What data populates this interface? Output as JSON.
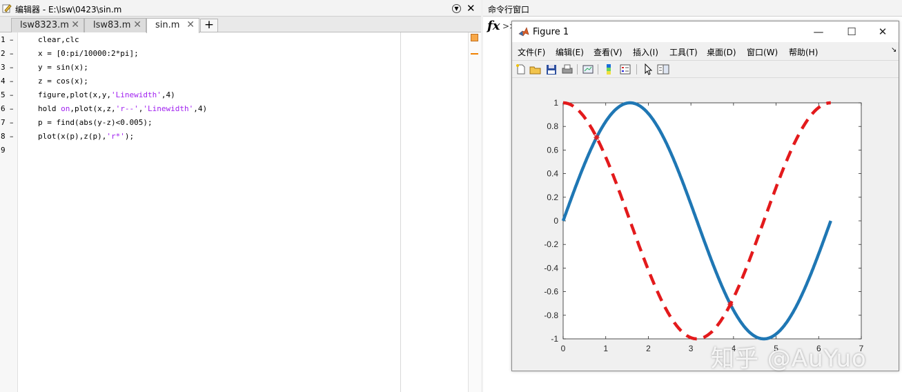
{
  "editor": {
    "title": "编辑器 - E:\\lsw\\0423\\sin.m",
    "tabs": [
      {
        "label": "lsw8323.m",
        "active": false
      },
      {
        "label": "lsw83.m",
        "active": false
      },
      {
        "label": "sin.m",
        "active": true
      }
    ],
    "add_tab": "+",
    "line_numbers": [
      "1",
      "2",
      "3",
      "4",
      "5",
      "6",
      "7",
      "8",
      "9"
    ],
    "line_markers": [
      "–",
      "–",
      "–",
      "–",
      "–",
      "–",
      "–",
      "–",
      ""
    ],
    "code": [
      [
        {
          "t": "clear,clc"
        }
      ],
      [
        {
          "t": "x = [0:pi/10000:2*pi];"
        }
      ],
      [
        {
          "t": "y = sin(x);"
        }
      ],
      [
        {
          "t": "z = cos(x);"
        }
      ],
      [
        {
          "t": "figure,plot(x,y,"
        },
        {
          "t": "'Linewidth'",
          "s": 1
        },
        {
          "t": ",4)"
        }
      ],
      [
        {
          "t": "hold "
        },
        {
          "t": "on",
          "s": 1
        },
        {
          "t": ",plot(x,z,"
        },
        {
          "t": "'r--'",
          "s": 1
        },
        {
          "t": ","
        },
        {
          "t": "'Linewidth'",
          "s": 1
        },
        {
          "t": ",4)"
        }
      ],
      [
        {
          "t": "p = find(abs(y-z)<0.005);"
        }
      ],
      [
        {
          "t": "plot(x(p),z(p),"
        },
        {
          "t": "'r*'",
          "s": 1
        },
        {
          "t": ");"
        }
      ],
      []
    ]
  },
  "command_window": {
    "title": "命令行窗口",
    "fx": "fx",
    "prompt": ">>"
  },
  "figure": {
    "title": "Figure 1",
    "window_buttons": [
      "—",
      "☐",
      "✕"
    ],
    "menu": [
      "文件(F)",
      "编辑(E)",
      "查看(V)",
      "插入(I)",
      "工具(T)",
      "桌面(D)",
      "窗口(W)",
      "帮助(H)"
    ],
    "toolbar_icons": [
      "new-figure-icon",
      "open-file-icon",
      "save-icon",
      "print-icon",
      "link-plot-icon",
      "colorbar-icon",
      "legend-icon",
      "pointer-icon",
      "property-editor-icon"
    ]
  },
  "watermark": "知乎 @AuYuo",
  "colors": {
    "sin": "#1f77b4",
    "cos": "#e31a1c",
    "marker": "#e31a1c"
  },
  "chart_data": {
    "type": "line",
    "xlim": [
      0,
      7
    ],
    "ylim": [
      -1,
      1
    ],
    "xticks": [
      0,
      1,
      2,
      3,
      4,
      5,
      6,
      7
    ],
    "yticks": [
      1,
      0.8,
      0.6,
      0.4,
      0.2,
      0,
      -0.2,
      -0.4,
      -0.6,
      -0.8,
      -1
    ],
    "series": [
      {
        "function": "sin",
        "style": "solid",
        "x_range": [
          0,
          6.2832
        ]
      },
      {
        "function": "cos",
        "style": "dashed",
        "x_range": [
          0,
          6.2832
        ]
      }
    ],
    "intersections": [
      {
        "x": 0.7854,
        "y": 0.7071
      },
      {
        "x": 3.927,
        "y": -0.7071
      }
    ]
  }
}
